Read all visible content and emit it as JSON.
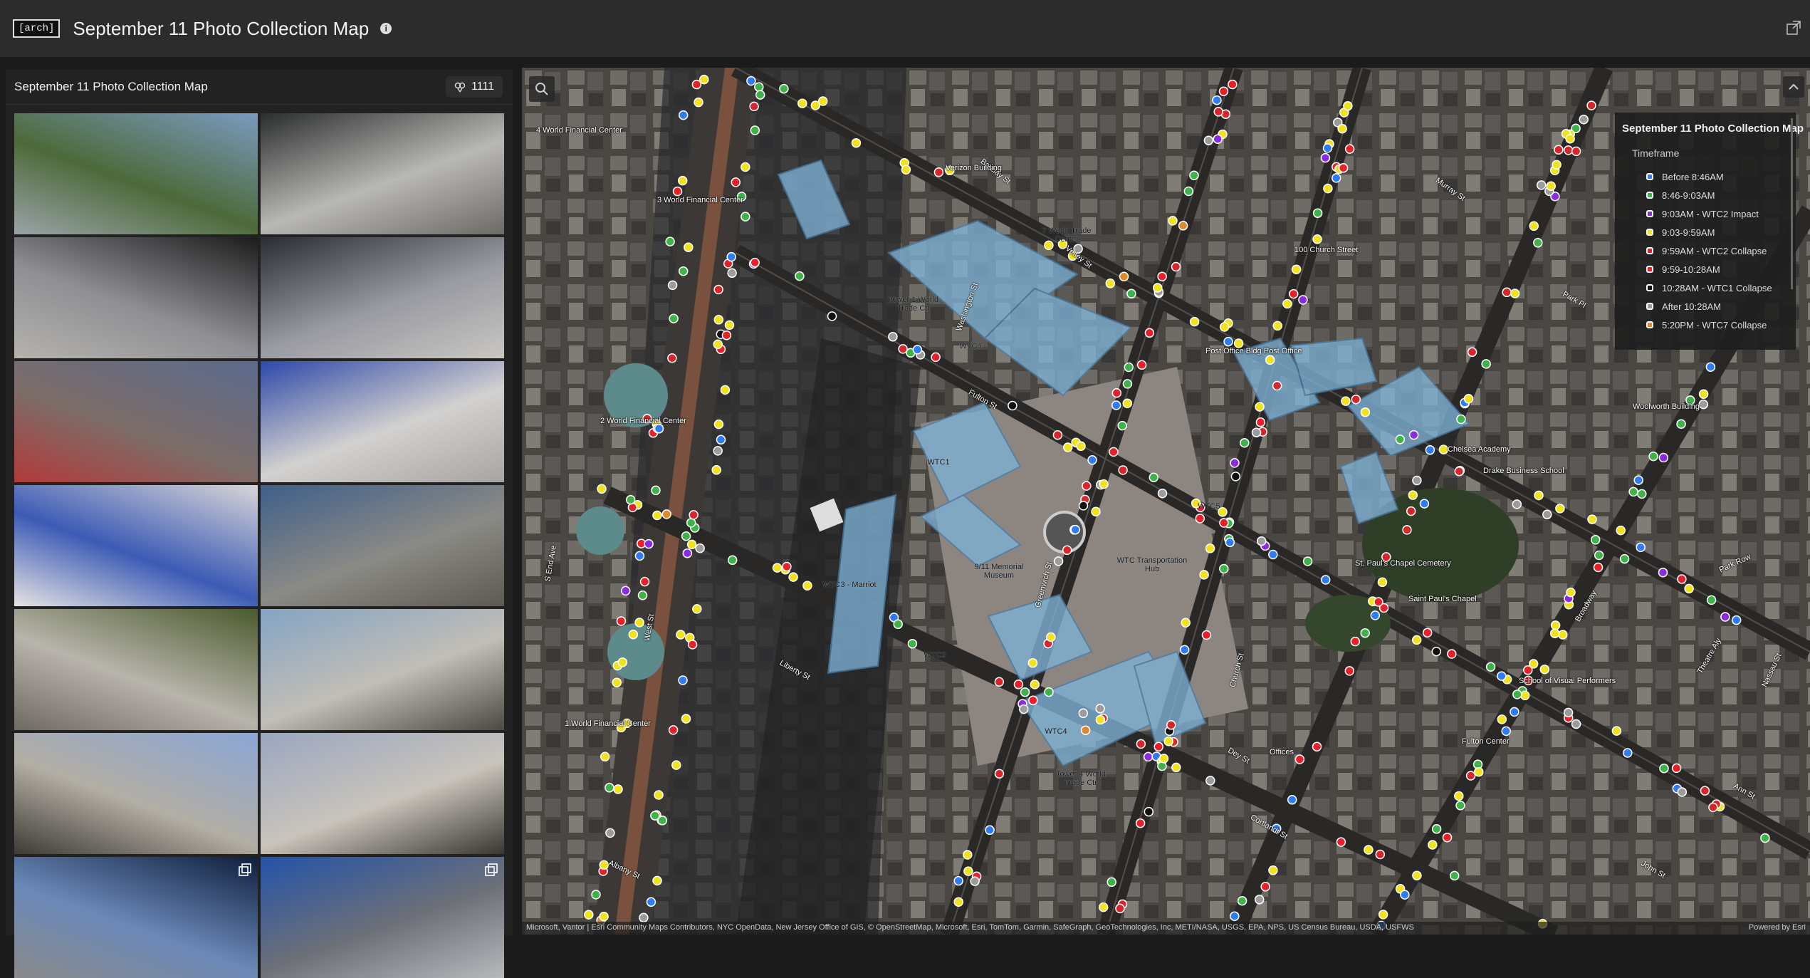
{
  "header": {
    "logo": "[arch]",
    "title": "September 11 Photo Collection Map",
    "info_icon": "info-icon",
    "share_icon": "open-external-icon"
  },
  "panel": {
    "title": "September 11 Photo Collection Map",
    "count": "1111",
    "count_icon": "photo-cluster-icon",
    "thumbnails": [
      {
        "colors": [
          "#7a9ac0",
          "#4d6a3a",
          "#9aa3a8"
        ]
      },
      {
        "colors": [
          "#2b2d2e",
          "#b9b8b4",
          "#6d6a66"
        ]
      },
      {
        "colors": [
          "#1c1c1c",
          "#8e8f94",
          "#b6b3ad"
        ]
      },
      {
        "colors": [
          "#2a2c35",
          "#9a9ba3",
          "#c9c7c2"
        ]
      },
      {
        "colors": [
          "#5b6b8e",
          "#7d6d68",
          "#b23a3a"
        ]
      },
      {
        "colors": [
          "#2d48a8",
          "#d3d1cf",
          "#a7a5a3"
        ]
      },
      {
        "colors": [
          "#d9d6d8",
          "#3c5bb5",
          "#e6e3e3"
        ]
      },
      {
        "colors": [
          "#3f5f8a",
          "#8b8a85",
          "#5d5a52"
        ]
      },
      {
        "colors": [
          "#4a5a2c",
          "#b8b4ac",
          "#6e6a63"
        ]
      },
      {
        "colors": [
          "#84a4c4",
          "#c2beb6",
          "#4b4943"
        ]
      },
      {
        "colors": [
          "#8aa6d6",
          "#b3aea4",
          "#3e3b36"
        ]
      },
      {
        "colors": [
          "#9aa6c0",
          "#c9c4bb",
          "#3a3733"
        ]
      },
      {
        "colors": [
          "#0e1e3c",
          "#6a88b8",
          "#8a8a8a"
        ]
      },
      {
        "colors": [
          "#2453a8",
          "#6d7078",
          "#b7b9bd"
        ]
      }
    ]
  },
  "map": {
    "search_icon": "search-icon",
    "collapse_icon": "chevron-up-icon",
    "labels": [
      {
        "text": "Barclay St"
      },
      {
        "text": "Washington St"
      },
      {
        "text": "Vesey St"
      },
      {
        "text": "Fulton St"
      },
      {
        "text": "Church St"
      },
      {
        "text": "Greenwich St"
      },
      {
        "text": "West St"
      },
      {
        "text": "Liberty St"
      },
      {
        "text": "Albany St"
      },
      {
        "text": "Park Pl"
      },
      {
        "text": "Murray St"
      },
      {
        "text": "Broadway"
      },
      {
        "text": "Cortlandt St"
      },
      {
        "text": "Dey St"
      },
      {
        "text": "Ann St"
      },
      {
        "text": "John St"
      },
      {
        "text": "Nassau St"
      },
      {
        "text": "Theatre Aly"
      },
      {
        "text": "Park Row"
      },
      {
        "text": "S End Ave"
      }
    ],
    "buildings": [
      {
        "text": "Tower 1 World Trade Ctr"
      },
      {
        "text": "WTC6"
      },
      {
        "text": "WTC1"
      },
      {
        "text": "7 World Trade Center"
      },
      {
        "text": "WTC5"
      },
      {
        "text": "WTC Transportation Hub"
      },
      {
        "text": "9/11 Memorial Museum"
      },
      {
        "text": "WTC3 - Marriot"
      },
      {
        "text": "WTC2"
      },
      {
        "text": "WTC4"
      },
      {
        "text": "Tower 4 World Trade Ctr"
      },
      {
        "text": "St. Paul's Chapel Cemetery"
      },
      {
        "text": "Saint Paul's Chapel"
      },
      {
        "text": "Drake Business School"
      },
      {
        "text": "Post Office Bldg Post Office"
      },
      {
        "text": "100 Church Street"
      },
      {
        "text": "Offices"
      },
      {
        "text": "Fulton Center"
      },
      {
        "text": "2 World Financial Center"
      },
      {
        "text": "3 World Financial Center"
      },
      {
        "text": "4 World Financial Center"
      },
      {
        "text": "1 World Financial Center"
      },
      {
        "text": "Verizon Building"
      },
      {
        "text": "School of Visual Performers"
      },
      {
        "text": "Woolworth Building"
      },
      {
        "text": "Chelsea Academy"
      }
    ],
    "attribution": "Microsoft, Vantor | Esri Community Maps Contributors, NYC OpenData, New Jersey Office of GIS, © OpenStreetMap, Microsoft, Esri, TomTom, Garmin, SafeGraph, GeoTechnologies, Inc, METI/NASA, USGS, EPA, NPS, US Census Bureau, USDA, USFWS",
    "powered_by": "Powered by Esri"
  },
  "legend": {
    "title": "September 11 Photo Collection Map",
    "subtitle": "Timeframe",
    "items": [
      {
        "label": "Before 8:46AM",
        "color": "#2f7cf6"
      },
      {
        "label": "8:46-9:03AM",
        "color": "#3fb34a"
      },
      {
        "label": "9:03AM - WTC2 Impact",
        "color": "#8a2be2"
      },
      {
        "label": "9:03-9:59AM",
        "color": "#f2e21c"
      },
      {
        "label": "9:59AM - WTC2 Collapse",
        "color": "#d7262b"
      },
      {
        "label": "9:59-10:28AM",
        "color": "#e8202a"
      },
      {
        "label": "10:28AM - WTC1 Collapse",
        "color": "#111111"
      },
      {
        "label": "After 10:28AM",
        "color": "#9c9c9c"
      },
      {
        "label": "5:20PM - WTC7 Collapse",
        "color": "#e0892a"
      }
    ]
  }
}
